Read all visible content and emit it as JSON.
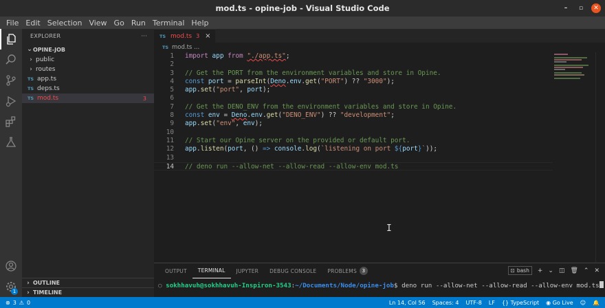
{
  "window": {
    "title": "mod.ts - opine-job - Visual Studio Code"
  },
  "menu": [
    "File",
    "Edit",
    "Selection",
    "View",
    "Go",
    "Run",
    "Terminal",
    "Help"
  ],
  "sidebar": {
    "header": "EXPLORER",
    "more": "···",
    "project": "OPINE-JOB",
    "items": [
      {
        "type": "folder",
        "label": "public"
      },
      {
        "type": "folder",
        "label": "routes"
      },
      {
        "type": "file",
        "label": "app.ts",
        "icon": "TS"
      },
      {
        "type": "file",
        "label": "deps.ts",
        "icon": "TS"
      },
      {
        "type": "file",
        "label": "mod.ts",
        "icon": "TS",
        "errors": "3"
      }
    ],
    "outline": "OUTLINE",
    "timeline": "TIMELINE"
  },
  "editor": {
    "tab": {
      "icon": "TS",
      "label": "mod.ts",
      "errors": "3",
      "close": "×"
    },
    "breadcrumb": {
      "icon": "TS",
      "label": "mod.ts ..."
    },
    "line_numbers": [
      "1",
      "2",
      "3",
      "4",
      "5",
      "6",
      "7",
      "8",
      "9",
      "10",
      "11",
      "12",
      "13",
      "14"
    ]
  },
  "panel": {
    "tabs": [
      "OUTPUT",
      "TERMINAL",
      "JUPYTER",
      "DEBUG CONSOLE",
      "PROBLEMS"
    ],
    "problems_count": "3",
    "shell": "bash",
    "terminal": {
      "user": "sokhhavuh@sokhhavuh-Inspiron-3543",
      "path": "~/Documents/Node/opine-job",
      "command": "$ deno run --allow-net --allow-read --allow-env mod.ts"
    }
  },
  "status": {
    "errors": "3",
    "warnings": "0",
    "position": "Ln 14, Col 56",
    "spaces": "Spaces: 4",
    "encoding": "UTF-8",
    "eol": "LF",
    "language": "TypeScript",
    "golive": "Go Live"
  },
  "colors": {
    "accent": "#007acc",
    "error": "#f14c4c"
  }
}
